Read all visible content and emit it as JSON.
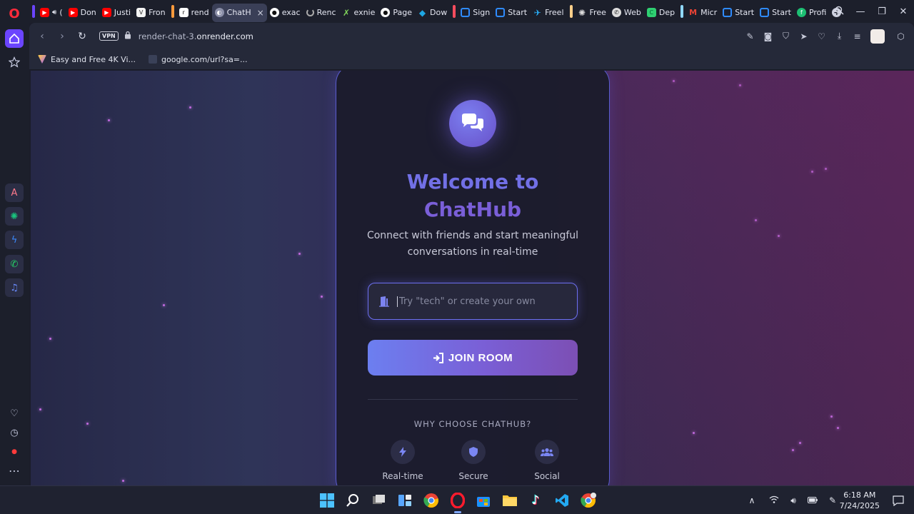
{
  "browser": {
    "tabs": [
      {
        "label": "(",
        "favicon": "youtube-icon",
        "color": "#ff0000"
      },
      {
        "label": "Don",
        "favicon": "youtube-icon",
        "color": "#ff0000"
      },
      {
        "label": "Justi",
        "favicon": "youtube-icon",
        "color": "#ff0000"
      },
      {
        "label": "Fron",
        "favicon": "vs-icon",
        "color": "#4a4a4a"
      },
      {
        "label": "rend",
        "favicon": "render-icon",
        "color": "#2d2d2d"
      },
      {
        "label": "ChatH",
        "favicon": "globe-icon",
        "color": "#7e7e9a",
        "active": true
      },
      {
        "label": "exac",
        "favicon": "github-icon",
        "color": "#1c1f2b"
      },
      {
        "label": "Renc",
        "favicon": "loading-icon",
        "color": "#1c1f2b"
      },
      {
        "label": "exnie",
        "favicon": "x-icon",
        "color": "#1c1f2b"
      },
      {
        "label": "Page",
        "favicon": "github-icon",
        "color": "#1c1f2b"
      },
      {
        "label": "Dow",
        "favicon": "download-icon",
        "color": "#1ea7e4"
      },
      {
        "label": "Sign",
        "favicon": "square-icon",
        "color": "#2f6fe0"
      },
      {
        "label": "Start",
        "favicon": "square-icon",
        "color": "#2f6fe0"
      },
      {
        "label": "Freel",
        "favicon": "freelancer-icon",
        "color": "#29b2fe"
      },
      {
        "label": "Free",
        "favicon": "openai-icon",
        "color": "#1c1f2b"
      },
      {
        "label": "Web",
        "favicon": "whatsapp-icon",
        "color": "#1c1f2b"
      },
      {
        "label": "Dep",
        "favicon": "c-icon",
        "color": "#2fd072"
      },
      {
        "label": "Micr",
        "favicon": "gmail-icon",
        "color": "#1c1f2b"
      },
      {
        "label": "Start",
        "favicon": "square-icon",
        "color": "#2f6fe0"
      },
      {
        "label": "Start",
        "favicon": "square-icon",
        "color": "#2f6fe0"
      },
      {
        "label": "Profi",
        "favicon": "fiverr-icon",
        "color": "#1dbf73"
      }
    ],
    "close_glyph": "×",
    "new_tab_glyph": "+",
    "vpn_label": "VPN",
    "url_prefix": "render-chat-3.",
    "url_domain": "onrender.com",
    "bookmarks": [
      {
        "label": "Easy and Free 4K Vi...",
        "icon": "vite-icon"
      },
      {
        "label": "google.com/url?sa=...",
        "icon": "bookmark-file-icon"
      }
    ]
  },
  "page": {
    "title_line1": "Welcome to",
    "title_line2": "ChatHub",
    "subtitle": "Connect with friends and start meaningful conversations in real-time",
    "room_input_placeholder": "Try \"tech\" or create your own",
    "room_input_value": "",
    "join_button_label": "JOIN ROOM",
    "why_heading": "WHY CHOOSE CHATHUB?",
    "features": [
      {
        "label": "Real-time",
        "icon": "bolt-icon"
      },
      {
        "label": "Secure",
        "icon": "shield-icon"
      },
      {
        "label": "Social",
        "icon": "users-icon"
      }
    ],
    "accent_color": "#6d6ff0",
    "button_gradient": [
      "#6c7ff0",
      "#7c4fb4"
    ]
  },
  "taskbar": {
    "time": "6:18 AM",
    "date": "7/24/2025",
    "apps": [
      "windows-start-icon",
      "search-icon",
      "task-view-icon",
      "widgets-icon",
      "chrome-icon",
      "opera-icon",
      "store-icon",
      "file-explorer-icon",
      "tiktok-icon",
      "vscode-icon",
      "chrome-profile-icon"
    ]
  }
}
